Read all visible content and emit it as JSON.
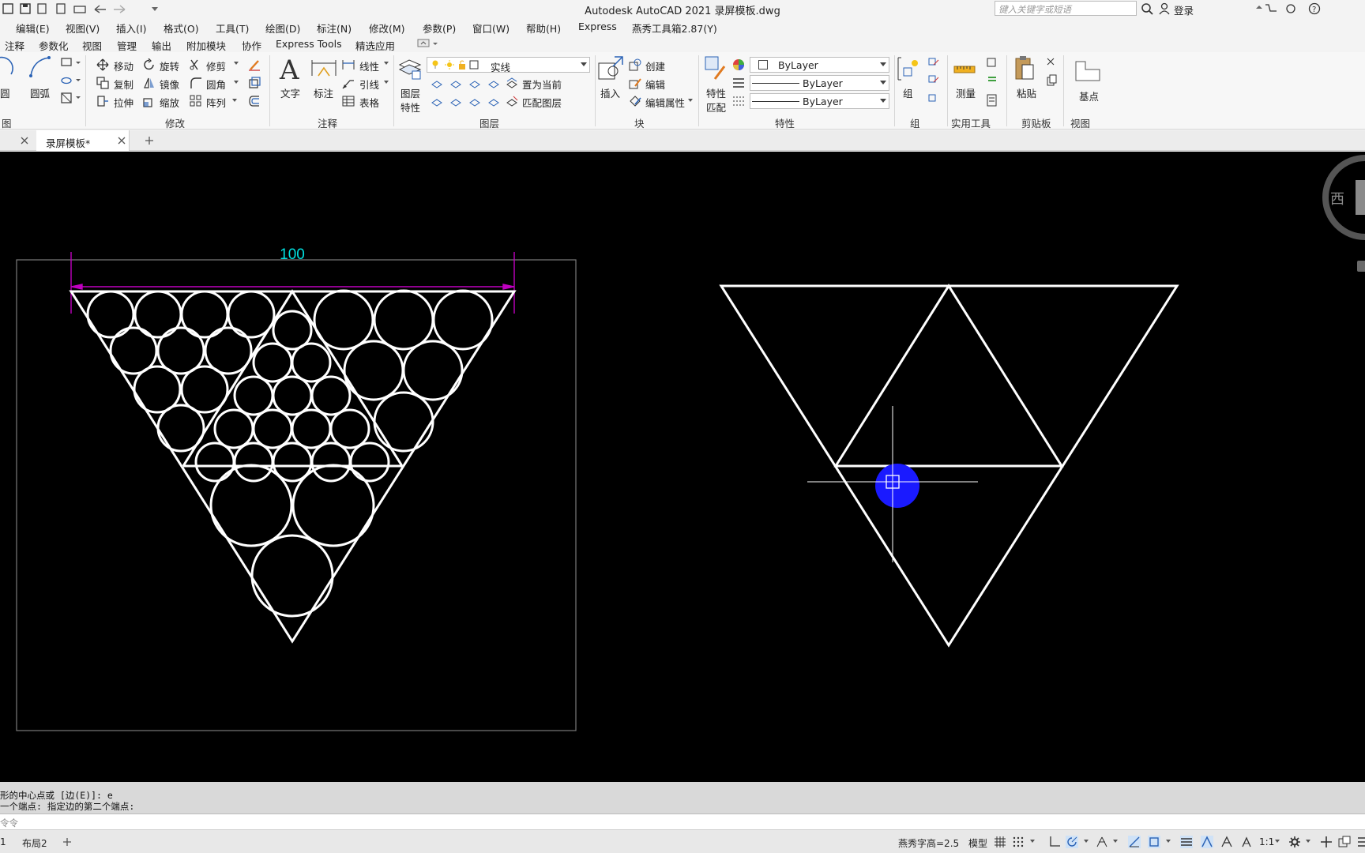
{
  "window": {
    "title": "Autodesk AutoCAD 2021    录屏模板.dwg",
    "search_placeholder": "键入关键字或短语",
    "login_label": "登录"
  },
  "menu": [
    "编辑(E)",
    "视图(V)",
    "插入(I)",
    "格式(O)",
    "工具(T)",
    "绘图(D)",
    "标注(N)",
    "修改(M)",
    "参数(P)",
    "窗口(W)",
    "帮助(H)",
    "Express",
    "燕秀工具箱2.87(Y)"
  ],
  "ribbon_tabs": [
    "注释",
    "参数化",
    "视图",
    "管理",
    "输出",
    "附加模块",
    "协作",
    "Express Tools",
    "精选应用"
  ],
  "ribbon": {
    "draw": {
      "circle": "圆",
      "arc": "圆弧",
      "group_label": "图"
    },
    "modify": {
      "move": "移动",
      "rotate": "旋转",
      "trim": "修剪",
      "copy": "复制",
      "mirror": "镜像",
      "fillet": "圆角",
      "stretch": "拉伸",
      "scale": "缩放",
      "array": "阵列",
      "group_label": "修改"
    },
    "annotation": {
      "text": "文字",
      "dimension": "标注",
      "linear": "线性",
      "leader": "引线",
      "table": "表格",
      "group_label": "注释"
    },
    "layers": {
      "layer_props_1": "图层",
      "layer_props_2": "特性",
      "current_layer": "实线",
      "set_current": "置为当前",
      "match_layer": "匹配图层",
      "group_label": "图层"
    },
    "block": {
      "insert": "插入",
      "create": "创建",
      "edit": "编辑",
      "edit_attributes": "编辑属性",
      "group_label": "块"
    },
    "properties": {
      "match_1": "特性",
      "match_2": "匹配",
      "color": "ByLayer",
      "linetype": "ByLayer",
      "lineweight": "ByLayer",
      "group_label": "特性"
    },
    "groups": {
      "group": "组",
      "group_label": "组"
    },
    "utilities": {
      "measure": "测量",
      "group_label": "实用工具"
    },
    "clipboard": {
      "paste": "粘贴",
      "group_label": "剪贴板"
    },
    "view": {
      "base": "基点",
      "group_label": "视图"
    }
  },
  "doc_tab": {
    "name": "录屏模板*"
  },
  "drawing": {
    "dimension_text": "100",
    "viewcube_label": "西"
  },
  "command_history": [
    "形的中心点或 [边(E)]: e",
    "一个端点: 指定边的第二个端点:"
  ],
  "command_prompt": "令令",
  "layout_tabs": [
    "1",
    "布局2"
  ],
  "status": {
    "yanxiu": "燕秀字高=2.5",
    "model": "模型",
    "scale": "1:1"
  },
  "colors": {
    "dimension_line": "#c000c0",
    "dimension_text": "#00e0e0",
    "geometry": "#ffffff",
    "cursor_highlight": "#1a1aff",
    "canvas": "#000000"
  }
}
